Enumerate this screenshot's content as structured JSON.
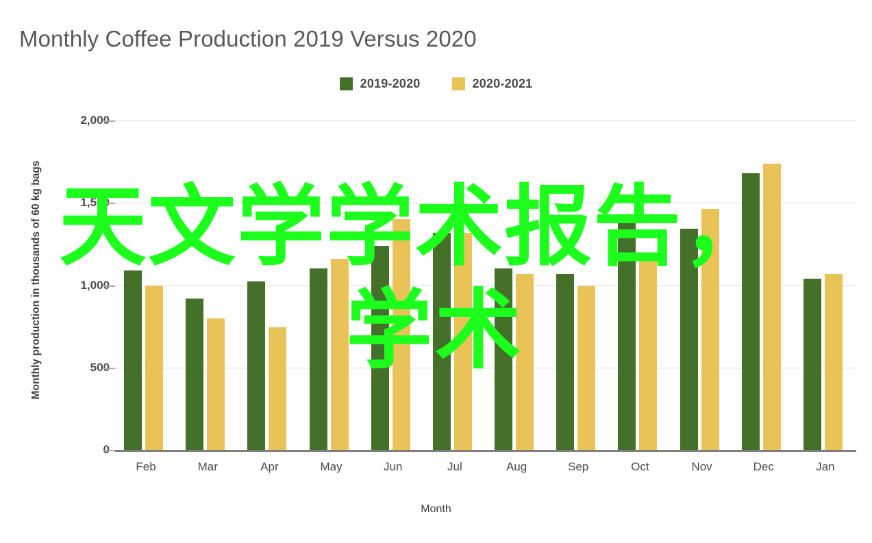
{
  "chart_data": {
    "type": "bar",
    "title": "Monthly Coffee Production 2019 Versus 2020",
    "xlabel": "Month",
    "ylabel": "Monthly production in thousands of 60 kg bags",
    "categories": [
      "Feb",
      "Mar",
      "Apr",
      "May",
      "Jun",
      "Jul",
      "Aug",
      "Sep",
      "Oct",
      "Nov",
      "Dec",
      "Jan"
    ],
    "series": [
      {
        "name": "2019-2020",
        "color": "#44702a",
        "values": [
          1090,
          920,
          1025,
          1100,
          1240,
          1320,
          1100,
          1070,
          1395,
          1345,
          1680,
          1040
        ]
      },
      {
        "name": "2020-2021",
        "color": "#e9c357",
        "values": [
          1000,
          800,
          745,
          1160,
          1400,
          1320,
          1070,
          995,
          1150,
          1465,
          1740,
          1070
        ]
      }
    ],
    "ylim": [
      0,
      2000
    ],
    "yticks": [
      0,
      500,
      1000,
      1500,
      2000
    ],
    "ytick_labels": [
      "0",
      "500",
      "1,000",
      "1,500",
      "2,000"
    ],
    "grid": true,
    "legend_position": "top-center"
  },
  "legend": {
    "items": [
      {
        "label": "2019-2020",
        "color": "#44702a"
      },
      {
        "label": "2020-2021",
        "color": "#e9c357"
      }
    ]
  },
  "overlay": {
    "line1": "天文学学术报告，",
    "line2": "学术",
    "color": "#1cff1c"
  }
}
